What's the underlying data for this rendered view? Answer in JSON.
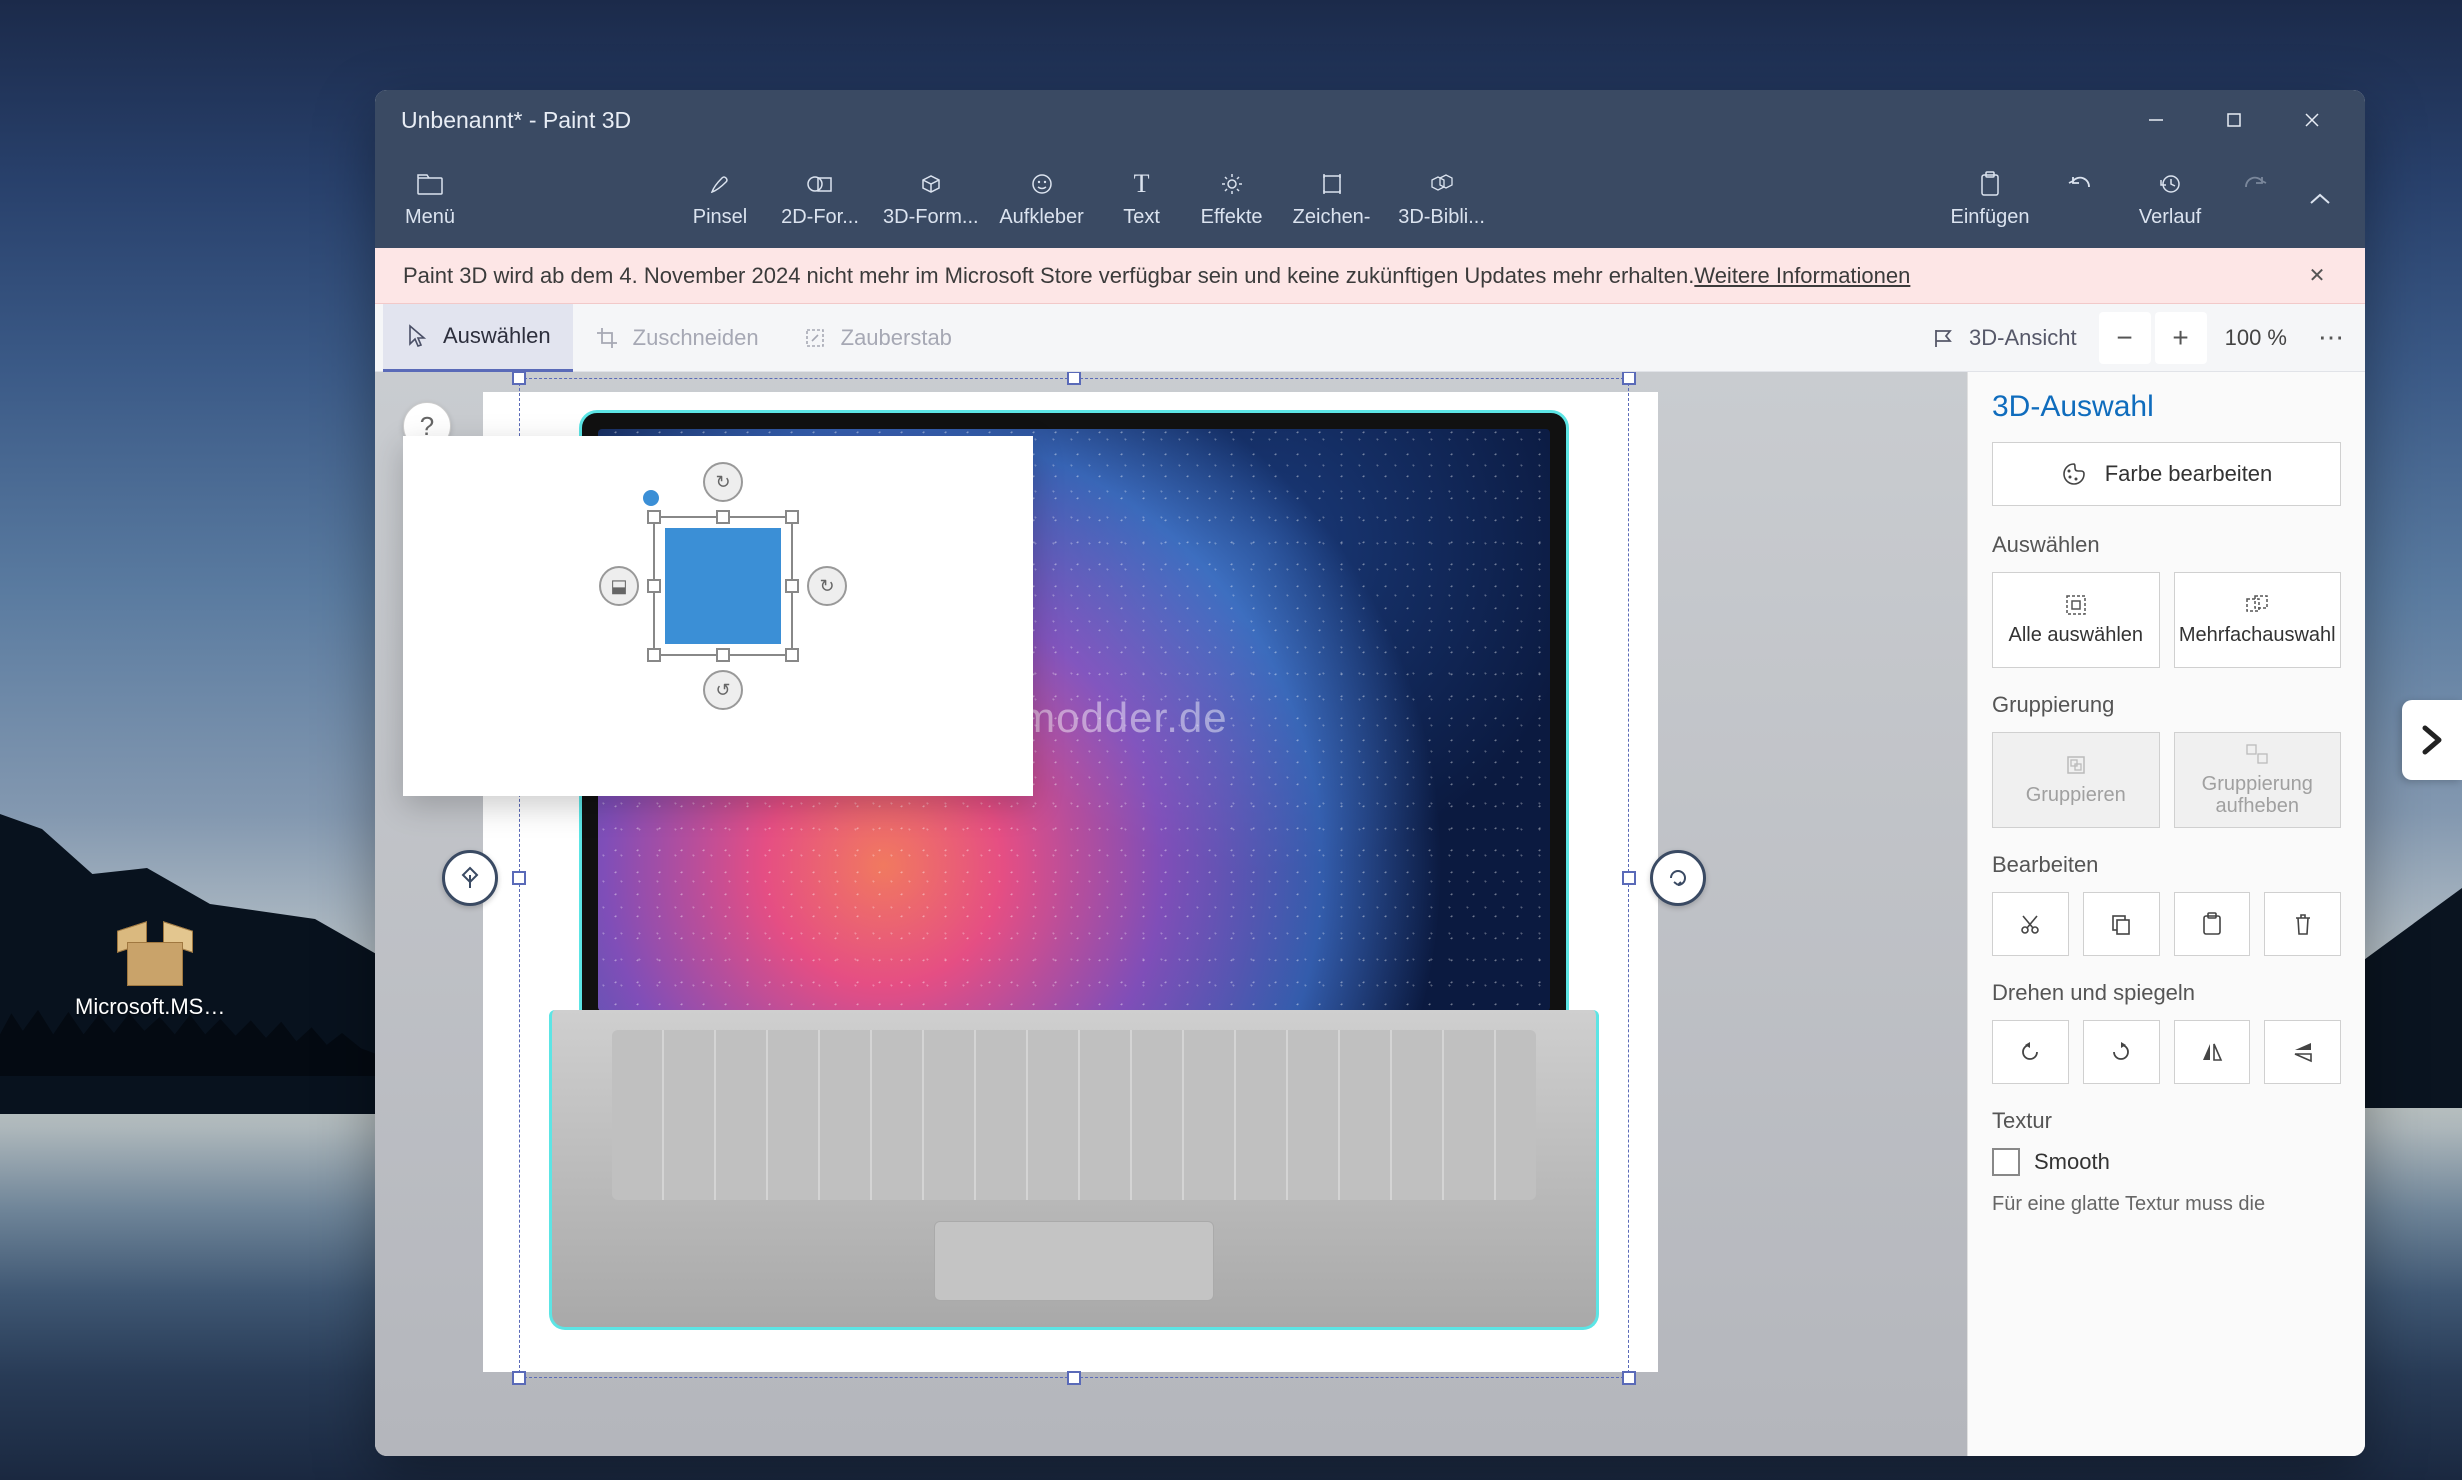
{
  "desktop": {
    "icon_label": "Microsoft.MSPaint_..."
  },
  "window": {
    "title": "Unbenannt* - Paint 3D"
  },
  "ribbon": {
    "menu": "Menü",
    "brush": "Pinsel",
    "shapes2d": "2D-For...",
    "shapes3d": "3D-Form...",
    "stickers": "Aufkleber",
    "text": "Text",
    "effects": "Effekte",
    "zeichen": "Zeichen-",
    "library3d": "3D-Bibli...",
    "paste": "Einfügen",
    "history": "Verlauf"
  },
  "banner": {
    "text": "Paint 3D wird ab dem 4. November 2024 nicht mehr im Microsoft Store verfügbar sein und keine zukünftigen Updates mehr erhalten. ",
    "link": "Weitere Informationen"
  },
  "toolbar": {
    "select": "Auswählen",
    "crop": "Zuschneiden",
    "magic": "Zauberstab",
    "view3d": "3D-Ansicht",
    "zoom": "100 %"
  },
  "canvas": {
    "watermark": "Deskmodder.de"
  },
  "panel": {
    "title": "3D-Auswahl",
    "edit_color": "Farbe bearbeiten",
    "select_section": "Auswählen",
    "select_all": "Alle auswählen",
    "multi_select": "Mehrfachauswahl",
    "group_section": "Gruppierung",
    "group": "Gruppieren",
    "ungroup": "Gruppierung aufheben",
    "edit_section": "Bearbeiten",
    "rotate_section": "Drehen und spiegeln",
    "texture_section": "Textur",
    "smooth": "Smooth",
    "texture_note": "Für eine glatte Textur muss die"
  }
}
